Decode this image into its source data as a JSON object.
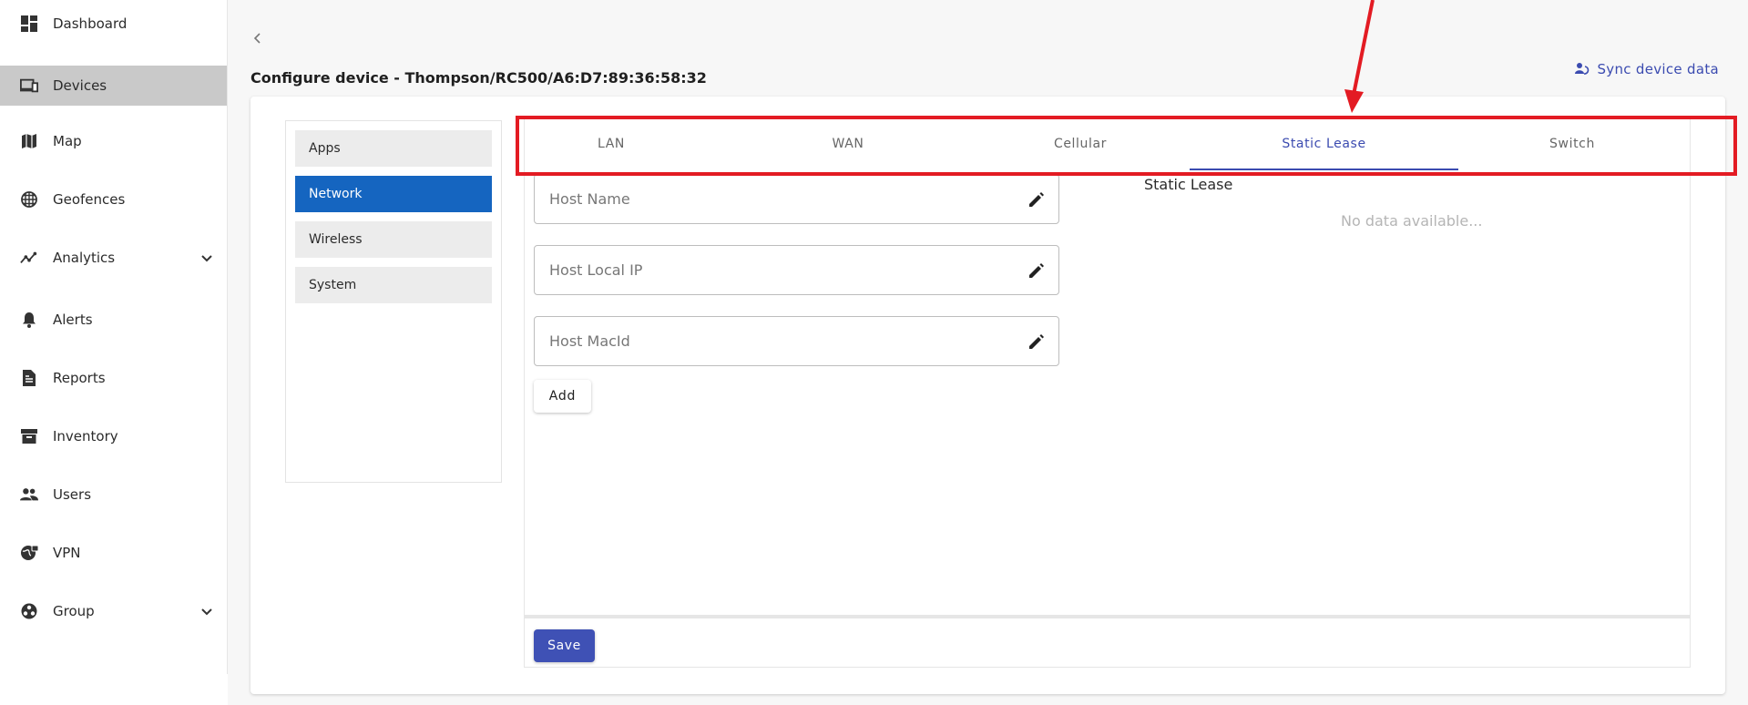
{
  "sidebar": {
    "items": [
      {
        "label": "Dashboard",
        "icon": "dashboard-icon"
      },
      {
        "label": "Devices",
        "icon": "devices-icon",
        "active": true
      },
      {
        "label": "Map",
        "icon": "map-icon"
      },
      {
        "label": "Geofences",
        "icon": "geofence-icon"
      },
      {
        "label": "Analytics",
        "icon": "analytics-icon",
        "expandable": true
      },
      {
        "label": "Alerts",
        "icon": "bell-icon"
      },
      {
        "label": "Reports",
        "icon": "reports-icon"
      },
      {
        "label": "Inventory",
        "icon": "inventory-icon"
      },
      {
        "label": "Users",
        "icon": "users-icon"
      },
      {
        "label": "VPN",
        "icon": "vpn-globe-icon"
      },
      {
        "label": "Group",
        "icon": "group-icon",
        "expandable": true
      }
    ]
  },
  "header": {
    "title": "Configure device - Thompson/RC500/A6:D7:89:36:58:32",
    "sync_label": "Sync device data"
  },
  "config_menu": {
    "items": [
      {
        "label": "Apps"
      },
      {
        "label": "Network",
        "active": true
      },
      {
        "label": "Wireless"
      },
      {
        "label": "System"
      }
    ]
  },
  "tabs": [
    {
      "label": "LAN"
    },
    {
      "label": "WAN"
    },
    {
      "label": "Cellular"
    },
    {
      "label": "Static Lease",
      "active": true
    },
    {
      "label": "Switch"
    }
  ],
  "form": {
    "host_name_placeholder": "Host Name",
    "host_ip_placeholder": "Host Local IP",
    "host_mac_placeholder": "Host MacId",
    "add_label": "Add"
  },
  "static_lease": {
    "title": "Static Lease",
    "empty_text": "No data available..."
  },
  "footer": {
    "save_label": "Save"
  },
  "colors": {
    "accent": "#3f51b5",
    "active_menu": "#1565c0",
    "sidebar_active": "#c9c9c9",
    "annotation": "#e31b23"
  }
}
